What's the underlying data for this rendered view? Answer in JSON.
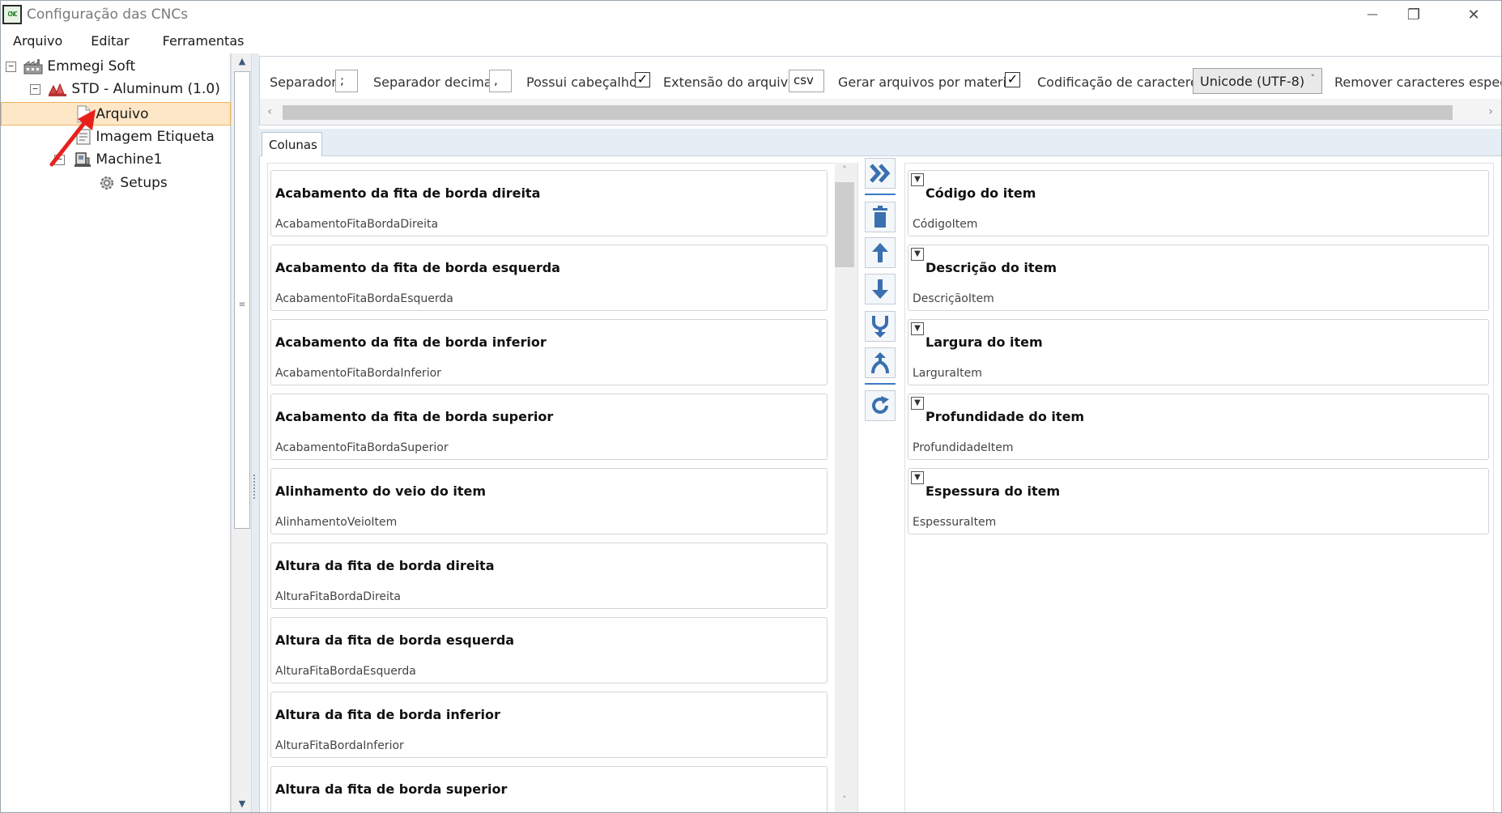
{
  "window": {
    "title": "Configuração das CNCs",
    "app_icon_text": "CNC",
    "controls": {
      "minimize": "—",
      "restore": "❐",
      "close": "✕"
    }
  },
  "menu": [
    "Arquivo",
    "Editar",
    "Ferramentas"
  ],
  "tree": {
    "root": "Emmegi Soft",
    "child": "STD - Aluminum (1.0)",
    "items": [
      "Arquivo",
      "Imagem Etiqueta",
      "Machine1",
      "Setups"
    ],
    "selected": "Arquivo"
  },
  "options": {
    "separator_label": "Separador",
    "separator_value": ";",
    "decimal_label": "Separador decimal",
    "decimal_value": ",",
    "header_label": "Possui cabeçalho",
    "header_checked": true,
    "extension_label": "Extensão do arquivo",
    "extension_value": "csv",
    "per_material_label": "Gerar arquivos por material",
    "per_material_checked": true,
    "encoding_label": "Codificação de caracteres",
    "encoding_value": "Unicode (UTF-8)",
    "remove_label": "Remover caracteres especia"
  },
  "tab": {
    "label": "Colunas"
  },
  "available_columns": [
    {
      "title": "Acabamento da fita de borda direita",
      "field": "AcabamentoFitaBordaDireita"
    },
    {
      "title": "Acabamento da fita de borda esquerda",
      "field": "AcabamentoFitaBordaEsquerda"
    },
    {
      "title": "Acabamento da fita de borda inferior",
      "field": "AcabamentoFitaBordaInferior"
    },
    {
      "title": "Acabamento da fita de borda superior",
      "field": "AcabamentoFitaBordaSuperior"
    },
    {
      "title": "Alinhamento do veio do item",
      "field": "AlinhamentoVeioItem"
    },
    {
      "title": "Altura da fita de borda direita",
      "field": "AlturaFitaBordaDireita"
    },
    {
      "title": "Altura da fita de borda esquerda",
      "field": "AlturaFitaBordaEsquerda"
    },
    {
      "title": "Altura da fita de borda inferior",
      "field": "AlturaFitaBordaInferior"
    },
    {
      "title": "Altura da fita de borda superior",
      "field": ""
    }
  ],
  "selected_columns": [
    {
      "title": "Código do item",
      "field": "CódigoItem"
    },
    {
      "title": "Descrição do item",
      "field": "DescriçãoItem"
    },
    {
      "title": "Largura do item",
      "field": "LarguraItem"
    },
    {
      "title": "Profundidade do item",
      "field": "ProfundidadeItem"
    },
    {
      "title": "Espessura do item",
      "field": "EspessuraItem"
    }
  ],
  "colors": {
    "accent_blue": "#3a6fb0",
    "selection_bg": "#fde7c7",
    "selection_border": "#f2b25c",
    "annotation_red": "#e8201c"
  }
}
